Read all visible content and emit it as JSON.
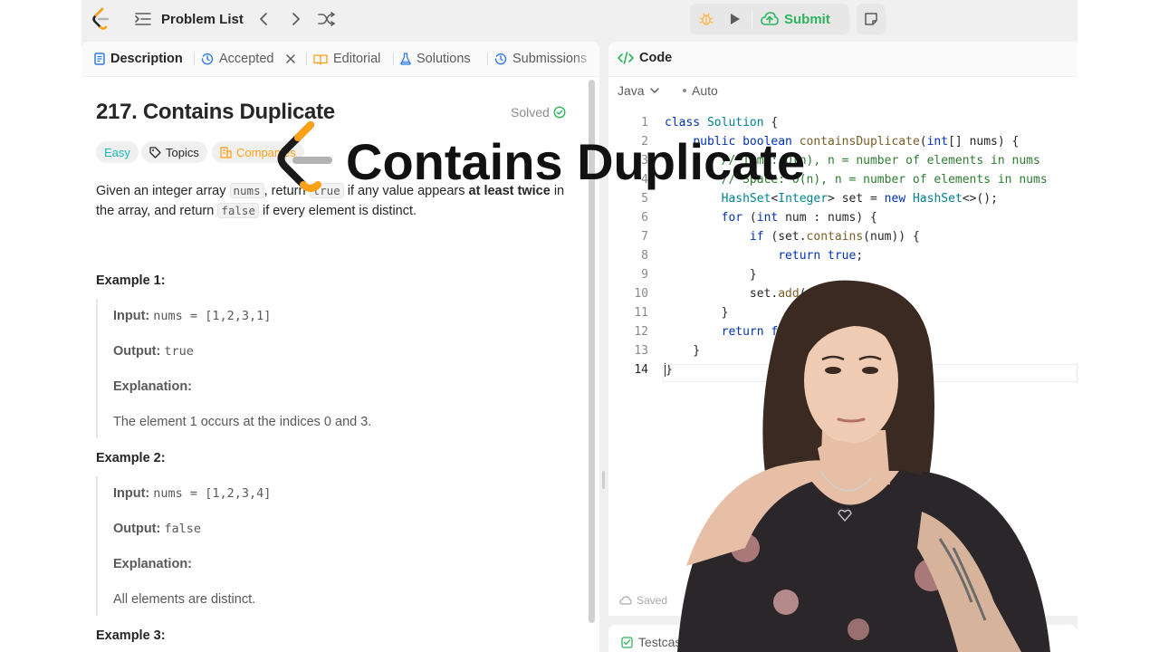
{
  "topbar": {
    "problem_list_label": "Problem List",
    "submit_label": "Submit"
  },
  "tabs": [
    {
      "label": "Description",
      "icon": "description-icon",
      "active": true
    },
    {
      "label": "Accepted",
      "icon": "history-icon",
      "active": false
    },
    {
      "label": "Editorial",
      "icon": "book-icon",
      "active": false
    },
    {
      "label": "Solutions",
      "icon": "flask-icon",
      "active": false
    },
    {
      "label": "Submissions",
      "icon": "history-icon",
      "active": false
    }
  ],
  "problem": {
    "title": "217. Contains Duplicate",
    "status": "Solved",
    "difficulty": "Easy",
    "topics_label": "Topics",
    "companies_label": "Companies",
    "desc_1": "Given an integer array ",
    "desc_code_1": "nums",
    "desc_2": ", return ",
    "desc_code_2": "true",
    "desc_3": " if any value appears ",
    "desc_bold": "at least twice",
    "desc_4": " in the array, and return ",
    "desc_code_3": "false",
    "desc_5": " if every element is distinct."
  },
  "examples": [
    {
      "heading": "Example 1:",
      "input_label": "Input:",
      "input_value": "nums = [1,2,3,1]",
      "output_label": "Output:",
      "output_value": "true",
      "explanation_label": "Explanation:",
      "explanation_text": "The element 1 occurs at the indices 0 and 3."
    },
    {
      "heading": "Example 2:",
      "input_label": "Input:",
      "input_value": "nums = [1,2,3,4]",
      "output_label": "Output:",
      "output_value": "false",
      "explanation_label": "Explanation:",
      "explanation_text": "All elements are distinct."
    },
    {
      "heading": "Example 3:"
    }
  ],
  "editor": {
    "tab_label": "Code",
    "language": "Java",
    "mode": "Auto",
    "saved_label": "Saved",
    "line_numbers": [
      "1",
      "2",
      "3",
      "4",
      "5",
      "6",
      "7",
      "8",
      "9",
      "10",
      "11",
      "12",
      "13",
      "14"
    ],
    "lines": [
      "class Solution {",
      "    public boolean containsDuplicate(int[] nums) {",
      "        // Time: O(n), n = number of elements in nums",
      "        // Space: O(n), n = number of elements in nums",
      "        HashSet<Integer> set = new HashSet<>();",
      "        for (int num : nums) {",
      "            if (set.contains(num)) {",
      "                return true;",
      "            }",
      "            set.add(num);",
      "        }",
      "        return false;",
      "    }",
      "}"
    ]
  },
  "bottom": {
    "test_tab_label": "Testcase"
  },
  "overlay": {
    "title": "Contains Duplicate"
  },
  "colors": {
    "submit_green": "#2db55d",
    "easy_teal": "#1cb8b8",
    "companies_orange": "#ffa116",
    "keyword_blue": "#0033b3",
    "comment_green": "#2e7d32"
  }
}
